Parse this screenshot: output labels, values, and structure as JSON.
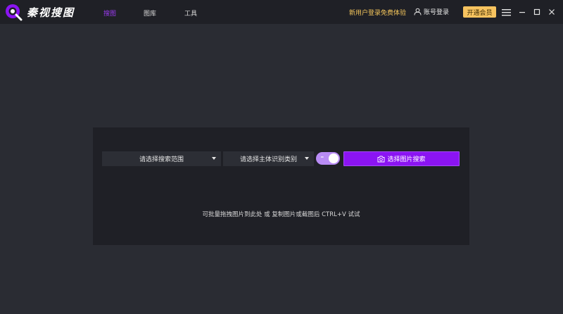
{
  "app": {
    "logo_text": "秦视搜图"
  },
  "nav": {
    "items": [
      {
        "label": "搜图",
        "active": true
      },
      {
        "label": "图库",
        "active": false
      },
      {
        "label": "工具",
        "active": false
      }
    ]
  },
  "header": {
    "promo": "新用户登录免费体验",
    "login_label": "账号登录",
    "vip_label": "开通会员"
  },
  "search": {
    "scope_placeholder": "请选择搜索范围",
    "category_placeholder": "请选择主体识别类别",
    "toggle_on": true,
    "button_label": "选择图片搜索",
    "hint": "可批量拖拽图片到此处 或 复制图片或截图后 CTRL+V 试试"
  },
  "colors": {
    "accent": "#8b14f2",
    "vip": "#f7c35f",
    "promo": "#f3c55b",
    "background": "#2a2c33",
    "panel": "#1f2026"
  },
  "icons": [
    "logo-icon",
    "user-icon",
    "menu-icon",
    "minimize-icon",
    "maximize-icon",
    "close-icon",
    "camera-icon",
    "chevron-down-icon"
  ]
}
